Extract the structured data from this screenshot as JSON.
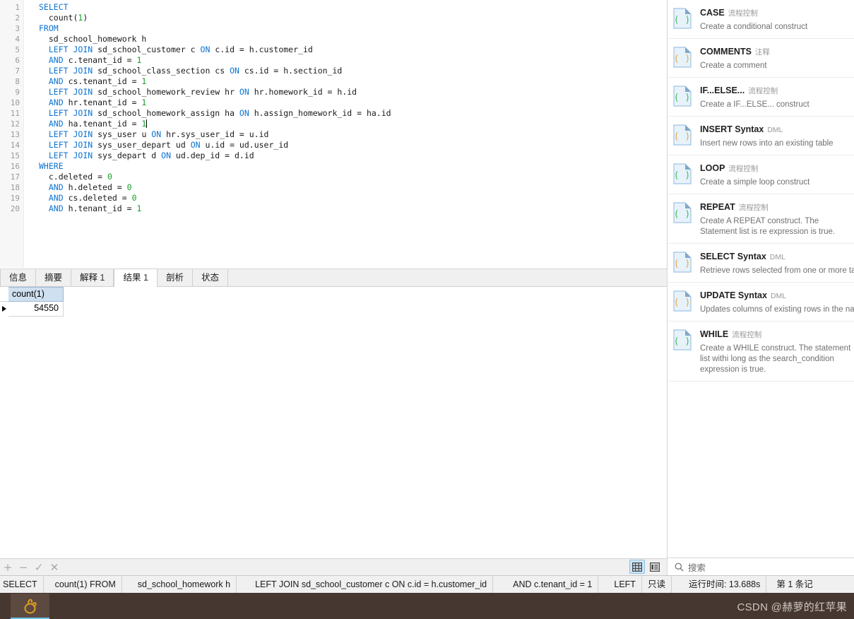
{
  "editor": {
    "line_numbers": [
      1,
      2,
      3,
      4,
      5,
      6,
      7,
      8,
      9,
      10,
      11,
      12,
      13,
      14,
      15,
      16,
      17,
      18,
      19,
      20
    ],
    "lines": [
      "SELECT",
      "  count(1)",
      "FROM",
      "  sd_school_homework h",
      "  LEFT JOIN sd_school_customer c ON c.id = h.customer_id",
      "  AND c.tenant_id = 1",
      "  LEFT JOIN sd_school_class_section cs ON cs.id = h.section_id",
      "  AND cs.tenant_id = 1",
      "  LEFT JOIN sd_school_homework_review hr ON hr.homework_id = h.id",
      "  AND hr.tenant_id = 1",
      "  LEFT JOIN sd_school_homework_assign ha ON h.assign_homework_id = ha.id",
      "  AND ha.tenant_id = 1",
      "  LEFT JOIN sys_user u ON hr.sys_user_id = u.id",
      "  LEFT JOIN sys_user_depart ud ON u.id = ud.user_id",
      "  LEFT JOIN sys_depart d ON ud.dep_id = d.id",
      "WHERE",
      "  c.deleted = 0",
      "  AND h.deleted = 0",
      "  AND cs.deleted = 0",
      "  AND h.tenant_id = 1"
    ],
    "colors": {
      "keyword": "#0d73d1",
      "number": "#17a02a",
      "text": "#1a1a1a",
      "gutter_bg": "#f7f7f7",
      "gutter_text": "#9a9a9a"
    }
  },
  "tabs": [
    {
      "label": "信息",
      "count": "",
      "active": false
    },
    {
      "label": "摘要",
      "count": "",
      "active": false
    },
    {
      "label": "解释",
      "count": "1",
      "active": false
    },
    {
      "label": "结果",
      "count": "1",
      "active": true
    },
    {
      "label": "剖析",
      "count": "",
      "active": false
    },
    {
      "label": "状态",
      "count": "",
      "active": false
    }
  ],
  "results": {
    "columns": [
      "count(1)"
    ],
    "rows": [
      [
        "54550"
      ]
    ]
  },
  "results_toolbar": {
    "buttons": [
      {
        "name": "add-record-button",
        "glyph": "+"
      },
      {
        "name": "remove-record-button",
        "glyph": "−"
      },
      {
        "name": "apply-changes-button",
        "glyph": "✓"
      },
      {
        "name": "cancel-changes-button",
        "glyph": "✕"
      }
    ],
    "view_modes": [
      {
        "name": "grid-view-button",
        "icon": "grid-icon",
        "selected": true
      },
      {
        "name": "form-view-button",
        "icon": "form-icon",
        "selected": false
      }
    ]
  },
  "sidebar": {
    "snippets": [
      {
        "title": "CASE",
        "tag": "流程控制",
        "desc": "Create a conditional construct",
        "icon": "code-snippet-icon",
        "accent": "#3fbf52",
        "wrap": false
      },
      {
        "title": "COMMENTS",
        "tag": "注释",
        "desc": "Create a comment",
        "icon": "code-snippet-icon",
        "accent": "#e8a93a",
        "wrap": false
      },
      {
        "title": "IF...ELSE...",
        "tag": "流程控制",
        "desc": "Create a IF...ELSE... construct",
        "icon": "code-snippet-icon",
        "accent": "#3fbf52",
        "wrap": false
      },
      {
        "title": "INSERT Syntax",
        "tag": "DML",
        "desc": "Insert new rows into an existing table",
        "icon": "code-snippet-icon",
        "accent": "#e8a93a",
        "wrap": false
      },
      {
        "title": "LOOP",
        "tag": "流程控制",
        "desc": "Create a simple loop construct",
        "icon": "code-snippet-icon",
        "accent": "#3fbf52",
        "wrap": false
      },
      {
        "title": "REPEAT",
        "tag": "流程控制",
        "desc": "Create A REPEAT construct. The Statement list is re expression is true.",
        "icon": "code-snippet-icon",
        "accent": "#3fbf52",
        "wrap": true
      },
      {
        "title": "SELECT Syntax",
        "tag": "DML",
        "desc": "Retrieve rows selected from one or more tables",
        "icon": "code-snippet-icon",
        "accent": "#e8a93a",
        "wrap": false
      },
      {
        "title": "UPDATE Syntax",
        "tag": "DML",
        "desc": "Updates columns of existing rows in the named ta",
        "icon": "code-snippet-icon",
        "accent": "#e8a93a",
        "wrap": false
      },
      {
        "title": "WHILE",
        "tag": "流程控制",
        "desc": "Create a WHILE construct. The statement list withi long as the search_condition expression is true.",
        "icon": "code-snippet-icon",
        "accent": "#3fbf52",
        "wrap": true
      }
    ]
  },
  "search": {
    "placeholder": "搜索",
    "icon": "search-icon"
  },
  "statusbar": {
    "segments": [
      "SELECT",
      "count(1) FROM",
      "sd_school_homework h",
      "LEFT JOIN sd_school_customer c ON c.id = h.customer_id",
      "AND c.tenant_id = 1",
      "LEFT",
      "只读",
      "运行时间: 13.688s",
      "第 1 条记"
    ]
  },
  "taskbar": {
    "app_icon": "navicat-icon",
    "watermark": "CSDN @赫萝的红苹果"
  }
}
